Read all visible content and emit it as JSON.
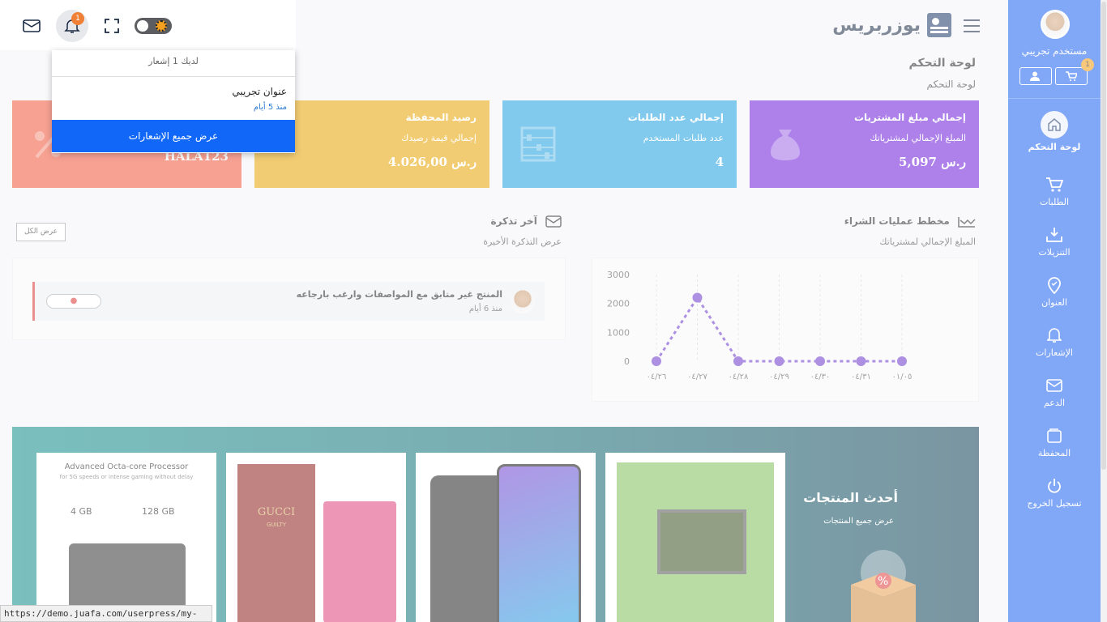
{
  "sidebar": {
    "user_name": "مستخدم تجريبي",
    "cart_badge": "1",
    "items": [
      {
        "label": "لوحة التحكم",
        "icon": "home-icon"
      },
      {
        "label": "الطلبات",
        "icon": "cart-icon"
      },
      {
        "label": "التنزيلات",
        "icon": "download-icon"
      },
      {
        "label": "العنوان",
        "icon": "location-icon"
      },
      {
        "label": "الإشعارات",
        "icon": "bell-icon"
      },
      {
        "label": "الدعم",
        "icon": "mail-icon"
      },
      {
        "label": "المحفظة",
        "icon": "wallet-icon"
      },
      {
        "label": "تسجيل الخروج",
        "icon": "power-icon"
      }
    ]
  },
  "header": {
    "brand": "يوزربريس",
    "page_title": "لوحة التحكم",
    "breadcrumb": "لوحة التحكم"
  },
  "cards": [
    {
      "title": "إجمالي مبلغ المشتريات",
      "subtitle": "المبلغ الإجمالي لمشترياتك",
      "value": "5,097 ر.س",
      "color": "#6a1bd8"
    },
    {
      "title": "إجمالي عدد الطلبات",
      "subtitle": "عدد طلبات المستخدم",
      "value": "4",
      "color": "#1a9ee0"
    },
    {
      "title": "رصيد المحفظة",
      "subtitle": "إجمالي قيمة رصيدك",
      "value": "4.026,00 ر.س",
      "color": "#e8a300"
    },
    {
      "title": "",
      "subtitle": "",
      "value": "HALA123",
      "color": "#f0553a"
    }
  ],
  "purchases": {
    "title": "مخطط عمليات الشراء",
    "subtitle": "المبلغ الإجمالي لمشترياتك"
  },
  "chart_data": {
    "type": "line",
    "categories": [
      "٠٤/٢٦",
      "٠٤/٢٧",
      "٠٤/٢٨",
      "٠٤/٢٩",
      "٠٤/٣٠",
      "٠٤/٣١",
      "٠١/٠٥"
    ],
    "values": [
      0,
      2200,
      0,
      0,
      0,
      0,
      0
    ],
    "yticks": [
      "3000",
      "2000",
      "1000",
      "0"
    ],
    "ylim": [
      0,
      3000
    ],
    "color": "#6a35c8"
  },
  "tickets": {
    "title": "آخر تذكرة",
    "subtitle": "عرض التذكرة الأخيرة",
    "view_all": "عرض الكل",
    "item_title": "المنتج غير متابق مع المواصفات وارغب بارجاعه",
    "item_time": "منذ 6 أيام",
    "status_icon": "circle-icon"
  },
  "banner": {
    "title": "أحدث المنتجات",
    "subtitle": "عرض جميع المنتجات",
    "product1_title": "Advanced Octa-core Processor",
    "product1_sub": "for 5G speeds or intense gaming without delay",
    "product1_ram": "4 GB",
    "product1_rom": "128 GB",
    "product2_brand": "GUCCI",
    "product2_name": "GUILTY"
  },
  "topbar": {
    "notif_count": "1"
  },
  "notifications": {
    "header": "لديك 1 إشعار",
    "item_title": "عنوان تجريبي",
    "item_time": "منذ 5 أيام",
    "view_all": "عرض جميع الإشعارات"
  },
  "status_url": "https://demo.juafa.com/userpress/my-account/"
}
